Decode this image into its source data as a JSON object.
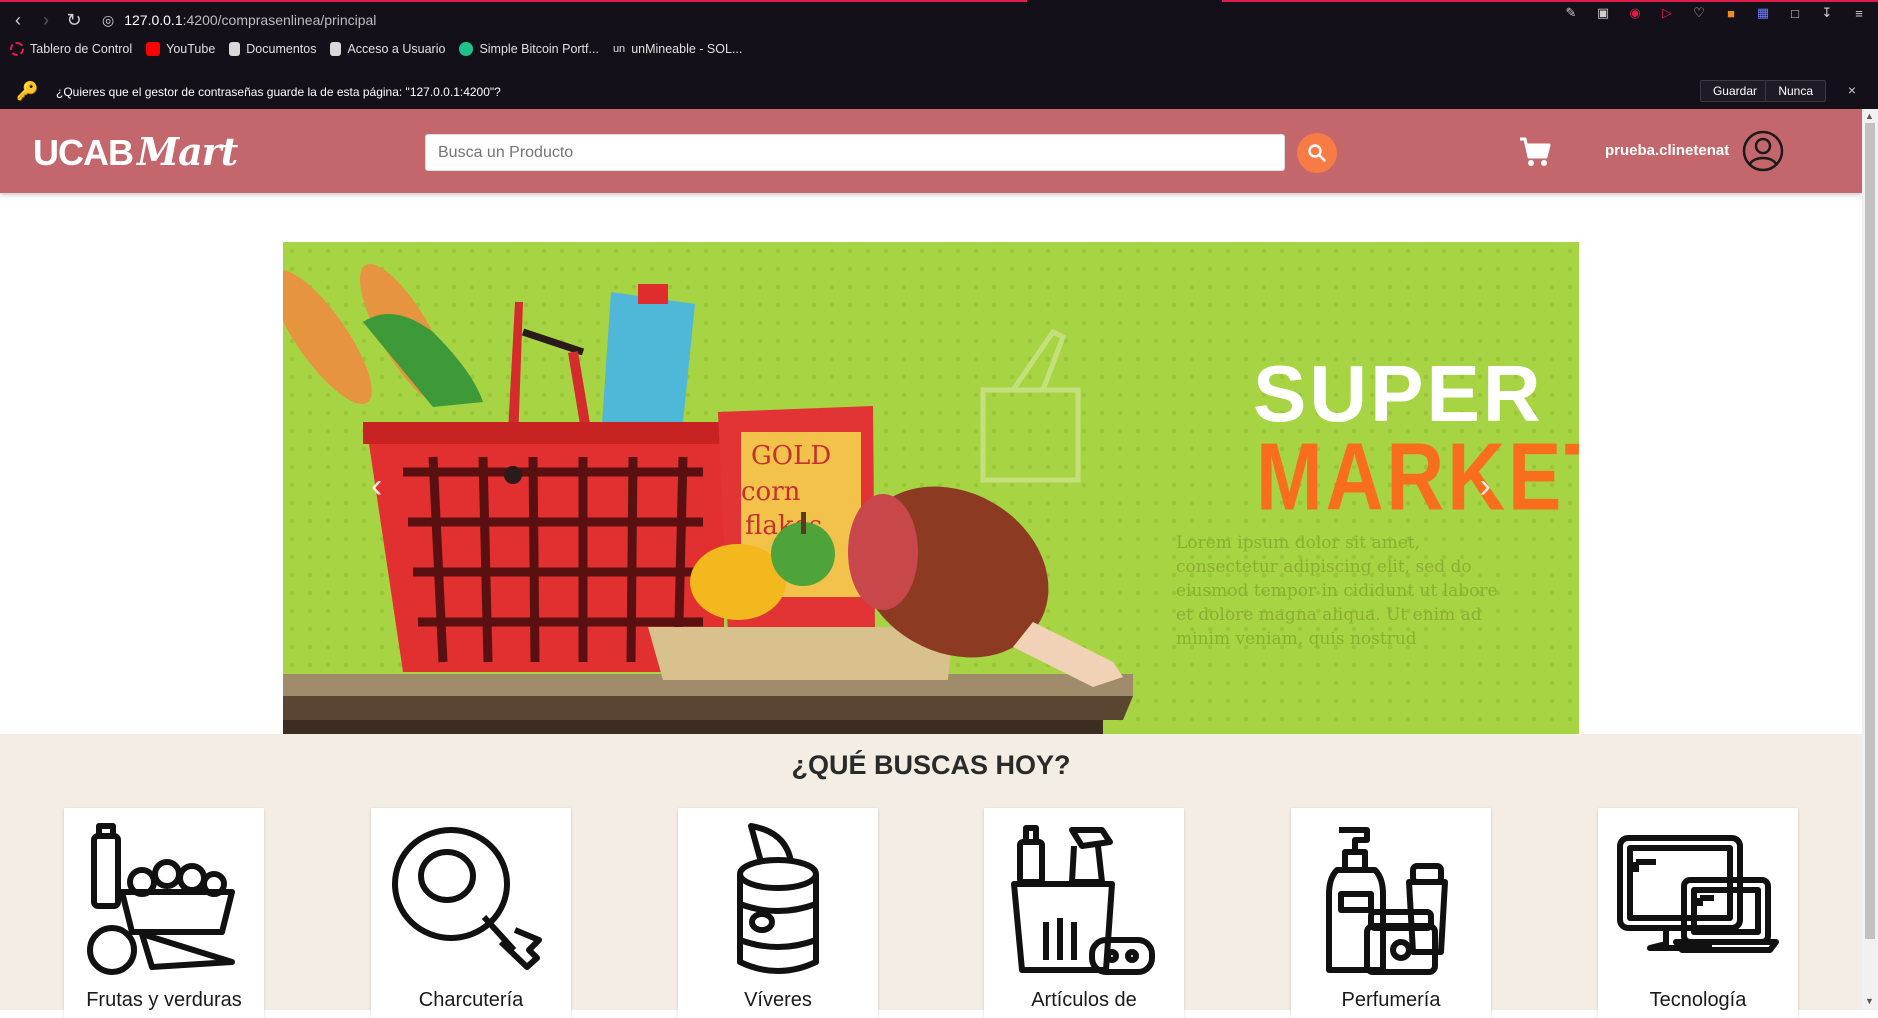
{
  "browser": {
    "url_host": "127.0.0.1",
    "url_rest": ":4200/comprasenlinea/principal",
    "bookmarks": [
      {
        "label": "Tablero de Control",
        "color": "#e01c4b"
      },
      {
        "label": "YouTube",
        "color": "#ff0000"
      },
      {
        "label": "Documentos",
        "color": "#ffffff"
      },
      {
        "label": "Acceso a Usuario",
        "color": "#ffffff"
      },
      {
        "label": "Simple Bitcoin Portf...",
        "color": "#1ec38b"
      },
      {
        "label": "unMineable - SOL...",
        "color": "#ffffff"
      }
    ],
    "password_prompt": "¿Quieres que el gestor de contraseñas guarde la de esta página: \"127.0.0.1:4200\"?",
    "save_label": "Guardar",
    "never_label": "Nunca",
    "close_glyph": "×"
  },
  "header": {
    "logo_main": "UCAB",
    "logo_script": "Mart",
    "search_placeholder": "Busca un Producto",
    "username": "prueba.clinetenat",
    "bg_color": "#c4676c",
    "search_button_color": "#f77b45"
  },
  "banner": {
    "line1": "SUPER",
    "line2": "MARKET",
    "lorem": "Lorem ipsum dolor sit amet, consectetur adipiscing elit, sed do eiusmod tempor in cididunt ut labore et dolore magna aliqua. Ut enim ad minim veniam, quis nostrud",
    "prev": "‹",
    "next": "›",
    "box_label_1": "GOLD",
    "box_label_2": "corn",
    "box_label_3": "flakes"
  },
  "categories": {
    "title": "¿QUÉ BUSCAS HOY?",
    "items": [
      {
        "label": "Frutas y verduras",
        "icon": "vegetables-icon"
      },
      {
        "label": "Charcutería",
        "icon": "ham-icon"
      },
      {
        "label": "Víveres",
        "icon": "can-icon"
      },
      {
        "label": "Artículos de",
        "icon": "cleaning-icon"
      },
      {
        "label": "Perfumería",
        "icon": "cosmetics-icon"
      },
      {
        "label": "Tecnología",
        "icon": "computer-icon"
      }
    ]
  }
}
